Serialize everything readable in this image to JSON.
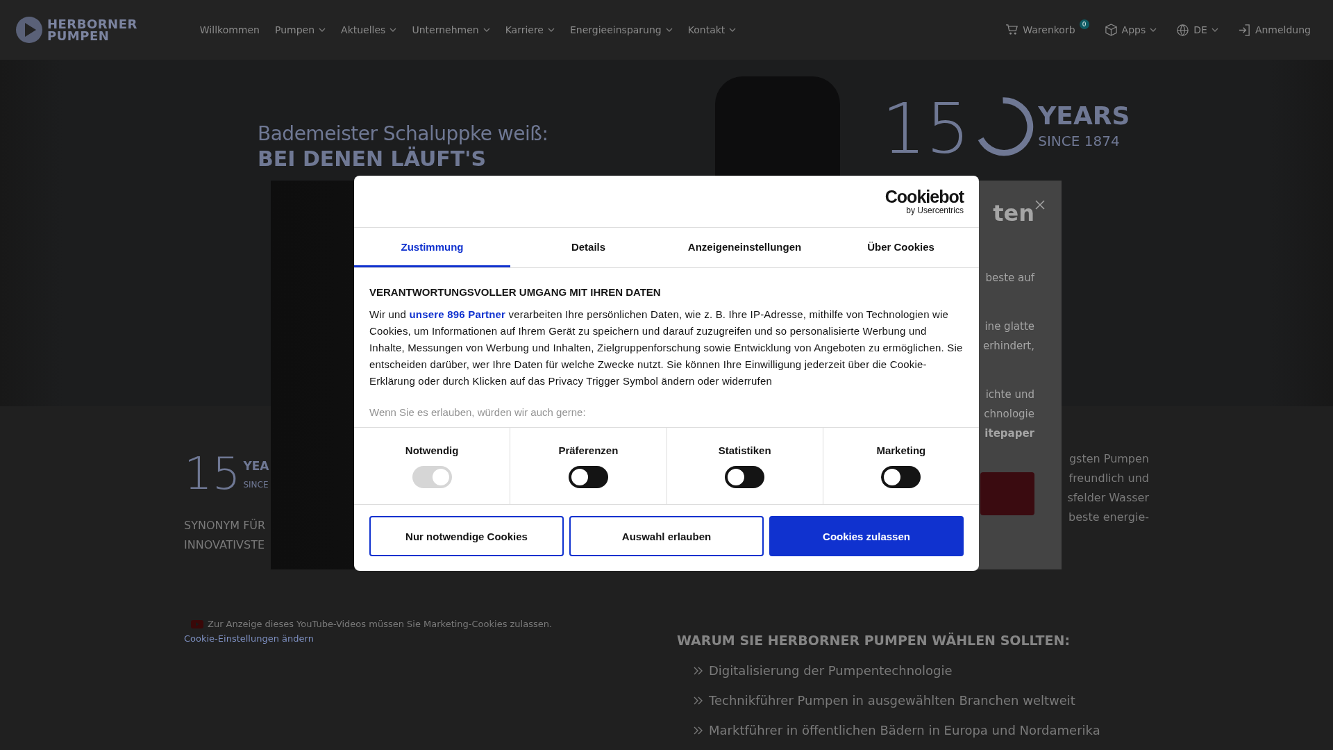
{
  "header": {
    "logo": {
      "line1": "HERBORNER",
      "line2": "PUMPEN"
    },
    "nav": [
      {
        "label": "Willkommen",
        "has_menu": false
      },
      {
        "label": "Pumpen",
        "has_menu": true
      },
      {
        "label": "Aktuelles",
        "has_menu": true
      },
      {
        "label": "Unternehmen",
        "has_menu": true
      },
      {
        "label": "Karriere",
        "has_menu": true
      },
      {
        "label": "Energieeinsparung",
        "has_menu": true
      },
      {
        "label": "Kontakt",
        "has_menu": true
      }
    ],
    "actions": [
      {
        "kind": "cart",
        "label": "Warenkorb",
        "badge": "0",
        "has_menu": false
      },
      {
        "kind": "apps",
        "label": "Apps",
        "has_menu": true
      },
      {
        "kind": "language",
        "label": "DE",
        "has_menu": true
      },
      {
        "kind": "login",
        "label": "Anmeldung",
        "has_menu": false
      }
    ]
  },
  "hero": {
    "kicker": "Bademeister Schaluppke weiß:",
    "headline": "BEI DENEN LÄUFT'S",
    "anniversary": {
      "figure": "15",
      "word": "YEARS",
      "since": "SINCE 1874"
    }
  },
  "promo_popup": {
    "title": "ten",
    "paragraphs": [
      {
        "lines": [
          {
            "text": "beste auf",
            "bold": false
          }
        ]
      },
      {
        "lines": [
          {
            "text": "ine glatte",
            "bold": false
          },
          {
            "text": "erhindert,",
            "bold": false
          }
        ]
      },
      {
        "lines": [
          {
            "text": "ichte und",
            "bold": false
          },
          {
            "text": "chnologie",
            "bold": false
          },
          {
            "text": "itepaper",
            "bold": true
          }
        ]
      }
    ]
  },
  "intro": {
    "anniversary": {
      "figure": "15",
      "word": "YEA",
      "since": "SINCE"
    },
    "tagline": [
      "SYNONYM FÜR",
      "INNOVATIVSTE"
    ],
    "video_notice": {
      "text": "Zur Anzeige dieses YouTube-Videos müssen Sie Marketing-Cookies zulassen.",
      "link": "Cookie-Einstellungen ändern"
    },
    "fragments": [
      "gsten Pumpen",
      "freundlich und",
      "sfelder Wasser",
      "beste energie-"
    ]
  },
  "why": {
    "title": "WARUM SIE HERBORNER PUMPEN WÄHLEN SOLLTEN:",
    "items": [
      "Digitalisierung der Pumpentechnologie",
      "Technikführer Pumpen in ausgewählten Branchen weltweit",
      "Marktführer in öffentlichen Bädern in Europa und Nordamerika"
    ]
  },
  "cookie_dialog": {
    "brand": "Cookiebot",
    "brand_sub": "by Usercentrics",
    "tabs": [
      {
        "label": "Zustimmung",
        "selected": true
      },
      {
        "label": "Details",
        "selected": false
      },
      {
        "label": "Anzeigeneinstellungen",
        "selected": false
      },
      {
        "label": "Über Cookies",
        "selected": false
      }
    ],
    "heading": "VERANTWORTUNGSVOLLER UMGANG MIT IHREN DATEN",
    "body_before": "Wir und",
    "body_link": "unsere 896 Partner",
    "body_after": "verarbeiten Ihre persönlichen Daten, wie z. B. Ihre IP-Adresse, mithilfe von Technologien wie Cookies, um Informationen auf Ihrem Gerät zu speichern und darauf zuzugreifen und so personalisierte Werbung und Inhalte, Messungen von Werbung und Inhalten, Zielgruppenforschung sowie Entwicklung von Angeboten zu ermöglichen. Sie entscheiden darüber, wer Ihre Daten für welche Zwecke nutzt. Sie können Ihre Einwilligung jederzeit über die Cookie-Erklärung oder durch Klicken auf das Privacy Trigger Symbol ändern oder widerrufen",
    "faded_note": "Wenn Sie es erlauben, würden wir auch gerne:",
    "categories": [
      {
        "label": "Notwendig",
        "checked": true,
        "disabled": true
      },
      {
        "label": "Präferenzen",
        "checked": false,
        "disabled": false
      },
      {
        "label": "Statistiken",
        "checked": false,
        "disabled": false
      },
      {
        "label": "Marketing",
        "checked": false,
        "disabled": false
      }
    ],
    "buttons": [
      {
        "label": "Nur notwendige Cookies",
        "kind": "outline"
      },
      {
        "label": "Auswahl erlauben",
        "kind": "outline"
      },
      {
        "label": "Cookies zulassen",
        "kind": "primary"
      }
    ]
  }
}
